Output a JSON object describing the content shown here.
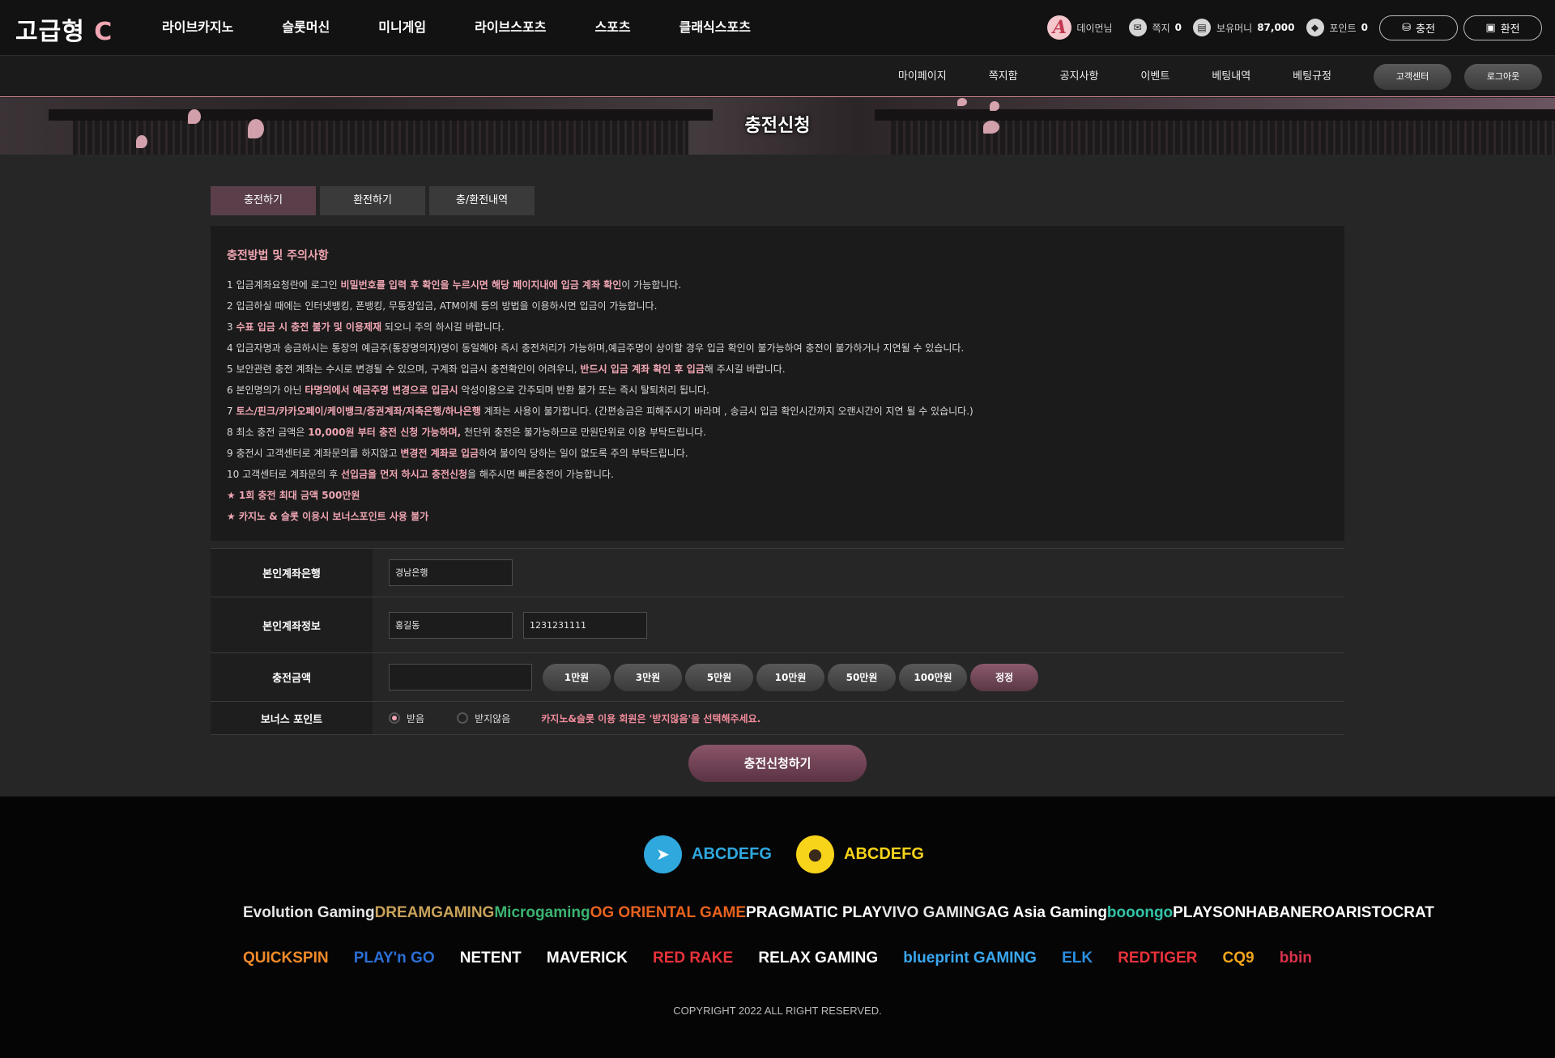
{
  "header": {
    "logo_main": "고급형",
    "logo_accent": "C",
    "nav": [
      "라이브카지노",
      "슬롯머신",
      "미니게임",
      "라이브스포츠",
      "스포츠",
      "클래식스포츠"
    ],
    "user_name": "데이먼님",
    "avatar_letter": "A",
    "message_label": "쪽지",
    "message_count": "0",
    "money_label": "보유머니",
    "money_value": "87,000",
    "point_label": "포인트",
    "point_value": "0",
    "deposit_button": "충전",
    "withdraw_button": "환전"
  },
  "subnav": {
    "items": [
      "마이페이지",
      "쪽지함",
      "공지사항",
      "이벤트",
      "베팅내역",
      "베팅규정"
    ],
    "support_button": "고객센터",
    "logout_button": "로그아웃"
  },
  "hero": {
    "title": "충전신청"
  },
  "tabs": [
    "충전하기",
    "환전하기",
    "충/환전내역"
  ],
  "notice": {
    "title": "충전방법 및 주의사항",
    "items": [
      [
        "1  입금계좌요청란에 로그인 ",
        {
          "h": "비밀번호를 입력 후 확인을 누르시면 해당 페이지내에 입금 계좌 확인"
        },
        "이 가능합니다."
      ],
      [
        "2  입금하실 때에는 인터넷뱅킹, 폰뱅킹, 무통장입금, ATM이체 등의 방법을 이용하시면 입금이 가능합니다."
      ],
      [
        "3  ",
        {
          "h": "수표 입금 시 충전 불가 및 이용제재"
        },
        " 되오니 주의 하시길 바랍니다."
      ],
      [
        "4  입금자명과 송금하시는 통장의 예금주(통장명의자)명이 동일해야 즉시 충전처리가 가능하며,예금주명이 상이할 경우 입금 확인이 불가능하여 충전이 불가하거나 지연될 수 있습니다."
      ],
      [
        "5  보안관련 충전 계좌는 수시로 변경될 수 있으며, 구계좌 입금시 충전확인이 어려우니, ",
        {
          "h": "반드시 입금 계좌 확인 후 입금"
        },
        "해 주시길 바랍니다."
      ],
      [
        "6  본인명의가 아닌 ",
        {
          "h": "타명의에서 예금주명 변경으로 입금시"
        },
        " 악성이용으로 간주되며 반환 불가 또는 즉시 탈퇴처리 됩니다."
      ],
      [
        "7  ",
        {
          "h": "토스/핀크/카카오페이/케이뱅크/증권계좌/저축은행/하나은행"
        },
        " 계좌는 사용이 불가합니다. (간편송금은 피해주시기 바라며 , 송금시 입금 확인시간까지 오랜시간이 지연 될 수 있습니다.)"
      ],
      [
        "8  최소 충전 금액은 ",
        {
          "h": "10,000원 부터 충전 신청 가능하며,"
        },
        " 천단위 충전은 불가능하므로 만원단위로 이용 부탁드립니다."
      ],
      [
        "9  충전시 고객센터로 계좌문의를 하지않고 ",
        {
          "h": "변경전 계좌로 입금"
        },
        "하여 불이익 당하는 일이 없도록 주의 부탁드립니다."
      ],
      [
        "10  고객센터로 계좌문의 후 ",
        {
          "h": "선입금을 먼저 하시고 충전신청"
        },
        "을 해주시면 빠른충전이 가능합니다."
      ]
    ],
    "stars": [
      "★  1회 충전 최대 금액 500만원",
      "★  카지노 & 슬롯 이용시 보너스포인트 사용 불가"
    ]
  },
  "form": {
    "bank_label": "본인계좌은행",
    "bank_value": "경남은행",
    "account_label": "본인계좌정보",
    "holder_value": "홍길동",
    "account_value": "1231231111",
    "amount_label": "충전금액",
    "amount_value": "",
    "amount_buttons": [
      "1만원",
      "3만원",
      "5만원",
      "10만원",
      "50만원",
      "100만원"
    ],
    "reset_button": "정정",
    "bonus_label": "보너스 포인트",
    "bonus_yes": "받음",
    "bonus_no": "받지않음",
    "bonus_note": "카지노&슬롯 이용 회원은 '받지않음'을 선택해주세요.",
    "submit_button": "충전신청하기"
  },
  "footer": {
    "telegram_id": "ABCDEFG",
    "kakao_id": "ABCDEFG",
    "providers_row1": [
      {
        "name": "Evolution Gaming",
        "color": "#e6e6e6"
      },
      {
        "name": "DREAMGAMING",
        "color": "#c9a25a"
      },
      {
        "name": "Microgaming",
        "color": "#3cb371"
      },
      {
        "name": "OG ORIENTAL GAME",
        "color": "#e8621f"
      },
      {
        "name": "PRAGMATIC PLAY",
        "color": "#ffffff"
      },
      {
        "name": "VIVO GAMING",
        "color": "#e6e6e6"
      },
      {
        "name": "AG Asia Gaming",
        "color": "#ffffff"
      },
      {
        "name": "booongo",
        "color": "#33c2a8"
      },
      {
        "name": "PLAYSON",
        "color": "#ffffff"
      },
      {
        "name": "HABANERO",
        "color": "#ffffff"
      },
      {
        "name": "ARISTOCRAT",
        "color": "#ffffff"
      }
    ],
    "providers_row2": [
      {
        "name": "QUICKSPIN",
        "color": "#f08a2a"
      },
      {
        "name": "PLAY'n GO",
        "color": "#2c6fd6"
      },
      {
        "name": "NETENT",
        "color": "#ffffff"
      },
      {
        "name": "MAVERICK",
        "color": "#ffffff"
      },
      {
        "name": "RED RAKE",
        "color": "#e8323a"
      },
      {
        "name": "RELAX GAMING",
        "color": "#ffffff"
      },
      {
        "name": "blueprint GAMING",
        "color": "#3aa7f0"
      },
      {
        "name": "ELK",
        "color": "#2a8ee0"
      },
      {
        "name": "REDTIGER",
        "color": "#e8323a"
      },
      {
        "name": "CQ9",
        "color": "#f2a61f"
      },
      {
        "name": "bbin",
        "color": "#d9324b"
      }
    ],
    "copyright": "COPYRIGHT 2022  ALL RIGHT RESERVED."
  }
}
